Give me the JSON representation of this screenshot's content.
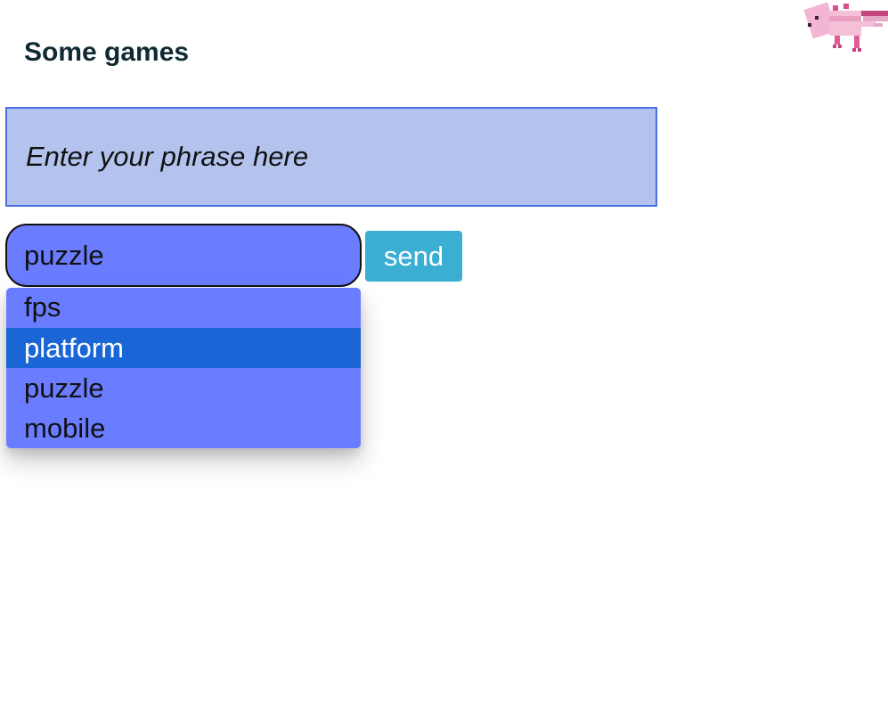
{
  "page": {
    "title": "Some games"
  },
  "mascot": {
    "icon": "pink-axolotl-icon"
  },
  "phrase_input": {
    "placeholder": "Enter your phrase here",
    "value": ""
  },
  "category_select": {
    "selected_value": "puzzle",
    "options": [
      "fps",
      "platform",
      "puzzle",
      "mobile"
    ],
    "highlighted_option": "platform"
  },
  "send_button": {
    "label": "send"
  },
  "colors": {
    "phrase_box_bg": "#b4c3ee",
    "phrase_box_border": "#4a6fe3",
    "select_bg": "#6a7cff",
    "highlight_bg": "#1a66d6",
    "send_bg": "#3aaed3"
  }
}
